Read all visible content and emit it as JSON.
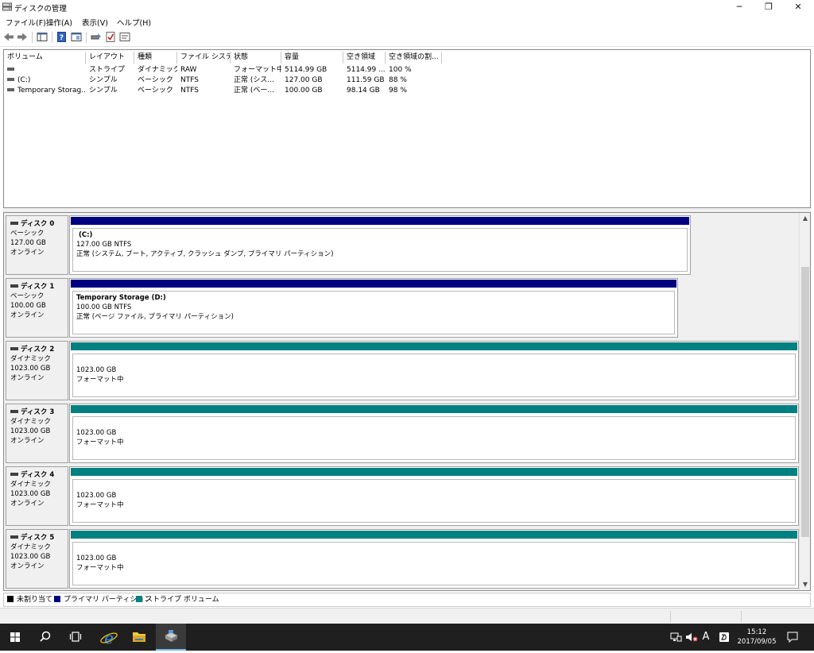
{
  "window": {
    "title": "ディスクの管理"
  },
  "menu": [
    "ファイル(F)",
    "操作(A)",
    "表示(V)",
    "ヘルプ(H)"
  ],
  "volumes": {
    "columns": [
      "ボリューム",
      "レイアウト",
      "種類",
      "ファイル システム",
      "状態",
      "容量",
      "空き領域",
      "空き領域の割..."
    ],
    "rows": [
      [
        "",
        "ストライプ",
        "ダイナミック",
        "RAW",
        "フォーマット中",
        "5114.99 GB",
        "5114.99 ...",
        "100 %"
      ],
      [
        "(C:)",
        "シンプル",
        "ベーシック",
        "NTFS",
        "正常 (シス...",
        "127.00 GB",
        "111.59 GB",
        "88 %"
      ],
      [
        "Temporary Storag...",
        "シンプル",
        "ベーシック",
        "NTFS",
        "正常 (ベー...",
        "100.00 GB",
        "98.14 GB",
        "98 %"
      ]
    ]
  },
  "disks": [
    {
      "name": "ディスク 0",
      "type": "ベーシック",
      "size": "127.00 GB",
      "status": "オンライン",
      "partition": {
        "kind": "primary",
        "name": "(C:)",
        "detail": "127.00 GB NTFS",
        "state": "正常 (システム, ブート, アクティブ, クラッシュ ダンプ, プライマリ パーティション)"
      }
    },
    {
      "name": "ディスク 1",
      "type": "ベーシック",
      "size": "100.00 GB",
      "status": "オンライン",
      "partition": {
        "kind": "primary",
        "name": "Temporary Storage  (D:)",
        "detail": "100.00 GB NTFS",
        "state": "正常 (ページ ファイル, プライマリ パーティション)"
      }
    },
    {
      "name": "ディスク 2",
      "type": "ダイナミック",
      "size": "1023.00 GB",
      "status": "オンライン",
      "partition": {
        "kind": "striped",
        "name": "",
        "detail": "1023.00 GB",
        "state": "フォーマット中"
      }
    },
    {
      "name": "ディスク 3",
      "type": "ダイナミック",
      "size": "1023.00 GB",
      "status": "オンライン",
      "partition": {
        "kind": "striped",
        "name": "",
        "detail": "1023.00 GB",
        "state": "フォーマット中"
      }
    },
    {
      "name": "ディスク 4",
      "type": "ダイナミック",
      "size": "1023.00 GB",
      "status": "オンライン",
      "partition": {
        "kind": "striped",
        "name": "",
        "detail": "1023.00 GB",
        "state": "フォーマット中"
      }
    },
    {
      "name": "ディスク 5",
      "type": "ダイナミック",
      "size": "1023.00 GB",
      "status": "オンライン",
      "partition": {
        "kind": "striped",
        "name": "",
        "detail": "1023.00 GB",
        "state": "フォーマット中"
      }
    }
  ],
  "legend": [
    {
      "label": "未割り当て",
      "color": "#000000"
    },
    {
      "label": "プライマリ パーティション",
      "color": "#000080"
    },
    {
      "label": "ストライプ ボリューム",
      "color": "#008080"
    }
  ],
  "colors": {
    "primary": "#000080",
    "striped": "#008080"
  },
  "taskbar": {
    "ime": "A",
    "time": "15:12",
    "date": "2017/09/05",
    "apps": [
      "start-icon",
      "search-icon",
      "task-view-icon",
      "internet-explorer-icon",
      "file-explorer-icon",
      "disk-management-icon"
    ]
  }
}
